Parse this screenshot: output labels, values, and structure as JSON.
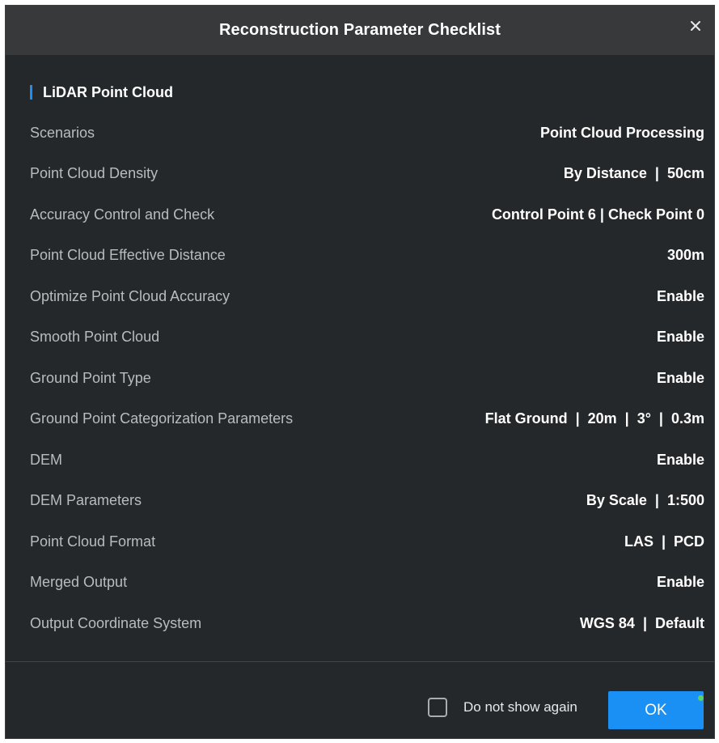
{
  "dialog": {
    "title": "Reconstruction Parameter Checklist",
    "close_icon": "close-icon"
  },
  "section": {
    "title": "LiDAR Point Cloud",
    "accent_color": "#1a90f5"
  },
  "params": [
    {
      "label": "Scenarios",
      "value": "Point Cloud Processing"
    },
    {
      "label": "Point Cloud Density",
      "value": "By Distance  |  50cm"
    },
    {
      "label": "Accuracy Control and Check",
      "value": "Control Point 6 | Check Point 0"
    },
    {
      "label": "Point Cloud Effective Distance",
      "value": "300m"
    },
    {
      "label": "Optimize Point Cloud Accuracy",
      "value": "Enable"
    },
    {
      "label": "Smooth Point Cloud",
      "value": "Enable"
    },
    {
      "label": "Ground Point Type",
      "value": "Enable"
    },
    {
      "label": "Ground Point Categorization Parameters",
      "value": "Flat Ground  |  20m  |  3°  |  0.3m"
    },
    {
      "label": "DEM",
      "value": "Enable"
    },
    {
      "label": "DEM Parameters",
      "value": "By Scale  |  1:500"
    },
    {
      "label": "Point Cloud Format",
      "value": "LAS  |  PCD"
    },
    {
      "label": "Merged Output",
      "value": "Enable"
    },
    {
      "label": "Output Coordinate System",
      "value": "WGS 84  |  Default"
    }
  ],
  "footer": {
    "dont_show_label": "Do not show again",
    "dont_show_checked": false,
    "ok_label": "OK",
    "ok_color": "#1a90f5"
  }
}
